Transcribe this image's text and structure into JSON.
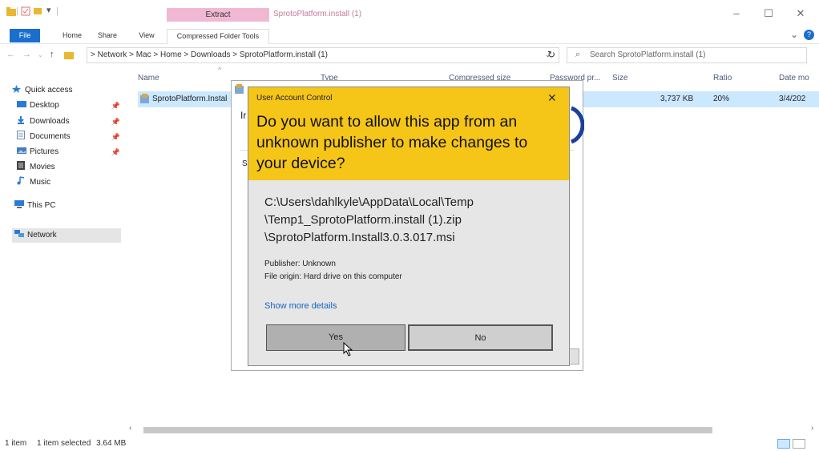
{
  "titlebar": {
    "contextual_tab": "Extract",
    "window_title": "SprotoPlatform.install (1)",
    "minimize": "–",
    "maximize": "☐",
    "close": "✕"
  },
  "ribbon": {
    "tabs": [
      "File",
      "Home",
      "Share",
      "View",
      "Compressed Folder Tools"
    ],
    "expand": "⌄",
    "help": "?"
  },
  "address": {
    "path": "> Network > Mac > Home > Downloads > SprotoPlatform.install (1)",
    "search_placeholder": "Search SprotoPlatform.install (1)"
  },
  "sidebar": {
    "items": [
      {
        "label": "Quick access",
        "icon": "star-icon",
        "pinned": false
      },
      {
        "label": "Desktop",
        "icon": "desktop-icon",
        "pinned": true
      },
      {
        "label": "Downloads",
        "icon": "download-icon",
        "pinned": true
      },
      {
        "label": "Documents",
        "icon": "documents-icon",
        "pinned": true
      },
      {
        "label": "Pictures",
        "icon": "pictures-icon",
        "pinned": true
      },
      {
        "label": "Movies",
        "icon": "movies-icon",
        "pinned": false
      },
      {
        "label": "Music",
        "icon": "music-icon",
        "pinned": false
      },
      {
        "label": "This PC",
        "icon": "pc-icon",
        "pinned": false
      },
      {
        "label": "Network",
        "icon": "network-icon",
        "pinned": false
      }
    ]
  },
  "filelist": {
    "columns": [
      "Name",
      "Type",
      "Compressed size",
      "Password pr...",
      "Size",
      "Ratio",
      "Date mo"
    ],
    "rows": [
      {
        "name": "SprotoPlatform.Instal",
        "size": "3,737 KB",
        "ratio": "20%",
        "date": "3/4/202"
      }
    ]
  },
  "installer_bg": {
    "fragment_a": "Ir",
    "fragment_b": "S"
  },
  "uac": {
    "caption": "User Account Control",
    "question": "Do you want to allow this app from an unknown publisher to make changes to your device?",
    "path_lines": [
      "C:\\Users\\dahlkyle\\AppData\\Local\\Temp",
      "\\Temp1_SprotoPlatform.install (1).zip",
      "\\SprotoPlatform.Install3.0.3.017.msi"
    ],
    "publisher": "Publisher: Unknown",
    "origin": "File origin: Hard drive on this computer",
    "more_details": "Show more details",
    "yes": "Yes",
    "no": "No",
    "colors": {
      "header": "#f5c518",
      "body": "#e6e6e6"
    }
  },
  "status": {
    "items": "1 item",
    "selected": "1 item selected",
    "size": "3.64 MB"
  }
}
